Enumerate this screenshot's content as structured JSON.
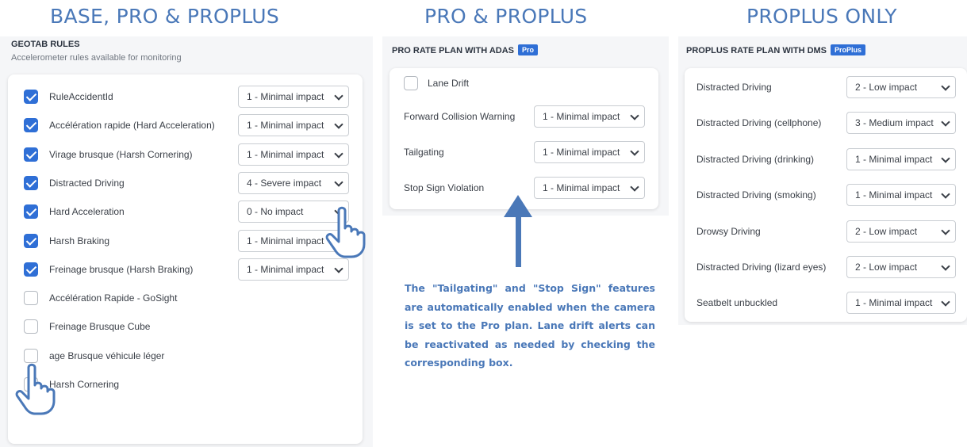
{
  "headers": {
    "base": "BASE, PRO & PROPLUS",
    "pro": "PRO & PROPLUS",
    "proplus": "PROPLUS ONLY"
  },
  "geotab": {
    "title": "GEOTAB RULES",
    "subtitle": "Accelerometer rules available for monitoring",
    "rules": [
      {
        "label": "RuleAccidentId",
        "checked": true,
        "impact": "1 - Minimal impact"
      },
      {
        "label": "Accélération rapide (Hard Acceleration)",
        "checked": true,
        "impact": "1 - Minimal impact"
      },
      {
        "label": "Virage brusque (Harsh Cornering)",
        "checked": true,
        "impact": "1 - Minimal impact"
      },
      {
        "label": "Distracted Driving",
        "checked": true,
        "impact": "4 - Severe impact"
      },
      {
        "label": "Hard Acceleration",
        "checked": true,
        "impact": "0 - No impact"
      },
      {
        "label": "Harsh Braking",
        "checked": true,
        "impact": "1 - Minimal impact"
      },
      {
        "label": "Freinage brusque (Harsh Braking)",
        "checked": true,
        "impact": "1 - Minimal impact"
      },
      {
        "label": "Accélération Rapide - GoSight",
        "checked": false,
        "impact": ""
      },
      {
        "label": "Freinage Brusque Cube",
        "checked": false,
        "impact": ""
      },
      {
        "label": "age Brusque véhicule léger",
        "checked": false,
        "impact": ""
      },
      {
        "label": "Harsh Cornering",
        "checked": false,
        "impact": ""
      }
    ]
  },
  "adas": {
    "title": "PRO RATE PLAN WITH ADAS",
    "badge": "Pro",
    "lane_drift": {
      "label": "Lane Drift",
      "checked": false
    },
    "rules": [
      {
        "label": "Forward Collision Warning",
        "impact": "1 - Minimal impact"
      },
      {
        "label": "Tailgating",
        "impact": "1 - Minimal impact"
      },
      {
        "label": "Stop Sign Violation",
        "impact": "1 - Minimal impact"
      }
    ]
  },
  "note": "The \"Tailgating\" and \"Stop Sign\" features are automatically enabled when the camera is set to the Pro plan. Lane drift alerts can be reactivated as needed by checking the corresponding box.",
  "dms": {
    "title": "PROPLUS RATE PLAN WITH DMS",
    "badge": "ProPlus",
    "rules": [
      {
        "label": "Distracted Driving",
        "impact": "2 - Low impact"
      },
      {
        "label": "Distracted Driving (cellphone)",
        "impact": "3 - Medium impact"
      },
      {
        "label": "Distracted Driving (drinking)",
        "impact": "1 - Minimal impact"
      },
      {
        "label": "Distracted Driving (smoking)",
        "impact": "1 - Minimal impact"
      },
      {
        "label": "Drowsy Driving",
        "impact": "2 - Low impact"
      },
      {
        "label": "Distracted Driving (lizard eyes)",
        "impact": "2 - Low impact"
      },
      {
        "label": "Seatbelt unbuckled",
        "impact": "1 - Minimal impact"
      }
    ]
  },
  "colors": {
    "accent": "#4a78b8",
    "checkbox": "#2f6fd6",
    "panel_bg": "#f5f6f8"
  },
  "icons": [
    "pointing-hand-icon",
    "up-arrow-icon",
    "chevron-down-icon",
    "checkmark-icon"
  ]
}
